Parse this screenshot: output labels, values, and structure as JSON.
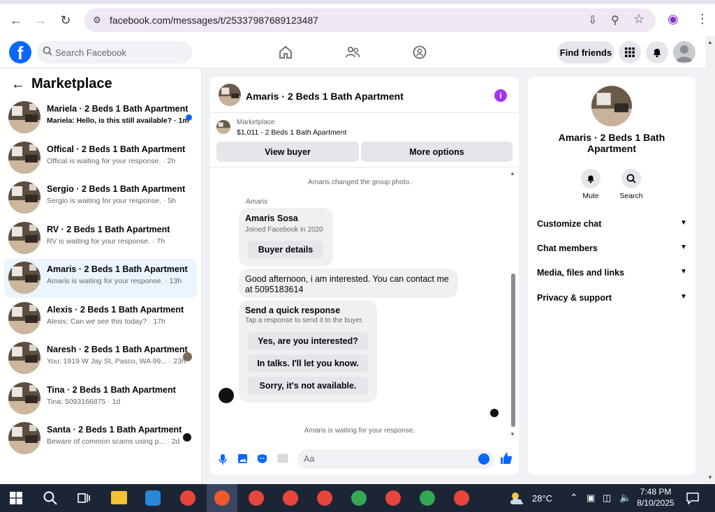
{
  "browser": {
    "url": "facebook.com/messages/t/25337987689123487"
  },
  "topbar": {
    "search_placeholder": "Search Facebook",
    "find_friends": "Find friends"
  },
  "left": {
    "title": "Marketplace",
    "conversations": [
      {
        "name": "Mariela · 2 Beds 1 Bath Apartment",
        "snippet": "Mariela: Hello, is this still available? · 1m",
        "unread": true
      },
      {
        "name": "Offical · 2 Beds 1 Bath Apartment",
        "snippet": "Offical is waiting for your response. · 2h"
      },
      {
        "name": "Sergio · 2 Beds 1 Bath Apartment",
        "snippet": "Sergio is waiting for your response. · 5h"
      },
      {
        "name": "RV · 2 Beds 1 Bath Apartment",
        "snippet": "RV is waiting for your response. · 7h"
      },
      {
        "name": "Amaris · 2 Beds 1 Bath Apartment",
        "snippet": "Amaris is waiting for your response. · 13h",
        "active": true
      },
      {
        "name": "Alexis · 2 Beds 1 Bath Apartment",
        "snippet": "Alexis: Can we see this today? · 17h"
      },
      {
        "name": "Naresh · 2 Beds 1 Bath Apartment",
        "snippet": "You: 1919 W Jay St, Pasco, WA 99... · 23h"
      },
      {
        "name": "Tina · 2 Beds 1 Bath Apartment",
        "snippet": "Tina: 5093166875 · 1d"
      },
      {
        "name": "Santa · 2 Beds 1 Bath Apartment",
        "snippet": "Beware of common scams using p... · 2d"
      }
    ]
  },
  "chat": {
    "title": "Amaris · 2 Beds 1 Bath Apartment",
    "listing_source": "Marketplace",
    "listing": "$1,011 - 2 Beds 1 Bath Apartment",
    "view_buyer": "View buyer",
    "more_options": "More options",
    "system_photo": "Amaris changed the group photo.",
    "sender_label": "Amaris",
    "card_name": "Amaris Sosa",
    "card_sub": "Joined Facebook in 2020",
    "buyer_details": "Buyer details",
    "message": "Good afternoon, i am interested. You can contact me at 5095183614",
    "quick_title": "Send a quick response",
    "quick_sub": "Tap a response to send it to the buyer.",
    "quick_options": [
      "Yes, are you interested?",
      "In talks. I'll let you know.",
      "Sorry, it's not available."
    ],
    "waiting": "Amaris is waiting for your response.",
    "composer_placeholder": "Aa"
  },
  "right": {
    "name": "Amaris · 2 Beds 1 Bath Apartment",
    "mute": "Mute",
    "search": "Search",
    "sections": [
      "Customize chat",
      "Chat members",
      "Media, files and links",
      "Privacy & support"
    ]
  },
  "taskbar": {
    "weather": "28°C",
    "time": "7:48 PM",
    "date": "8/10/2025"
  },
  "colors": {
    "brand": "#0866ff",
    "active_row": "#ebf5ff",
    "info": "#a033ff",
    "taskbar": "#1c2536"
  }
}
